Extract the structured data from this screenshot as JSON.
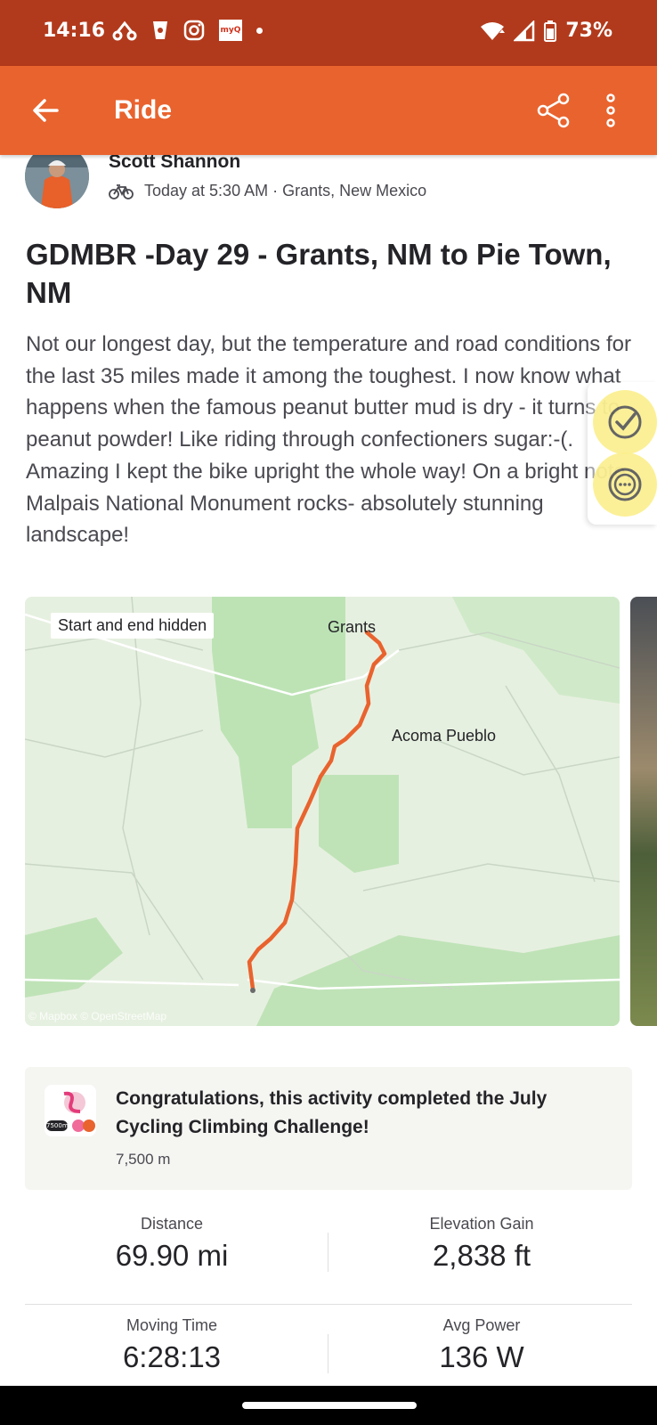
{
  "status_bar": {
    "time": "14:16",
    "battery": "73%",
    "icons_left": [
      "fork-icon",
      "cup-icon",
      "instagram-icon",
      "myq-icon",
      "notification-dot"
    ],
    "myq_label": "myQ",
    "icons_right": [
      "wifi-icon",
      "signal-icon",
      "battery-icon"
    ]
  },
  "app_bar": {
    "title": "Ride",
    "color": "#e9632e",
    "icons": [
      "back-arrow-icon",
      "share-icon",
      "more-vert-icon"
    ]
  },
  "athlete": {
    "name": "Scott Shannon",
    "meta": "Today at 5:30 AM · Grants, New Mexico",
    "activity_icon": "bike-icon"
  },
  "activity": {
    "title": "GDMBR -Day 29 - Grants, NM to Pie Town, NM",
    "description": "Not our longest day, but the temperature and road conditions for the last 35 miles made it among the toughest.  I now know what happens when the famous peanut butter mud is dry - it turns to peanut powder! Like riding through confectioners sugar:-(. Amazing I kept the bike upright the whole way!  On a bright note, Malpais National Monument rocks- absolutely stunning landscape!"
  },
  "floating_buttons": [
    "check-badge-icon",
    "chat-bubble-icon"
  ],
  "map": {
    "badge": "Start and end hidden",
    "labels": {
      "grants": "Grants",
      "acoma": "Acoma Pueblo"
    },
    "attribution": "© Mapbox © OpenStreetMap",
    "route_color": "#e9632e"
  },
  "challenge": {
    "text": "Congratulations, this activity completed the July Cycling Climbing Challenge!",
    "sub": "7,500 m",
    "badge_text": "7500m"
  },
  "stats": [
    {
      "label": "Distance",
      "value": "69.90 mi"
    },
    {
      "label": "Elevation Gain",
      "value": "2,838 ft"
    },
    {
      "label": "Moving Time",
      "value": "6:28:13"
    },
    {
      "label": "Avg Power",
      "value": "136 W"
    }
  ]
}
